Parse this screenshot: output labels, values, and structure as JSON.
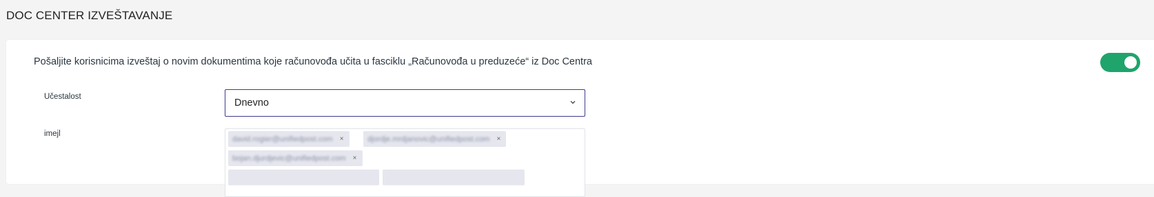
{
  "header": {
    "title": "DOC CENTER IZVEŠTAVANJE"
  },
  "report": {
    "description": "Pošaljite korisnicima izveštaj o novim dokumentima koje računovođa učita u fasciklu „Računovođa u preduzeće“ iz Doc Centra",
    "enabled": true,
    "toggle_color": "#1fa46b"
  },
  "frequency": {
    "label": "Učestalost",
    "value": "Dnevno",
    "icon": "chevron-down-icon"
  },
  "email": {
    "label": "imejl",
    "chips": [
      {
        "text": "david.rogier@unifiedpost.com",
        "remove": "×"
      },
      {
        "text": "djordje.mrdjanovic@unifiedpost.com",
        "remove": "×"
      },
      {
        "text": "bojan.djurdjevic@unifiedpost.com",
        "remove": "×"
      }
    ]
  },
  "colors": {
    "accent": "#3e3a8c",
    "chip_bg": "#e6e7ee"
  }
}
